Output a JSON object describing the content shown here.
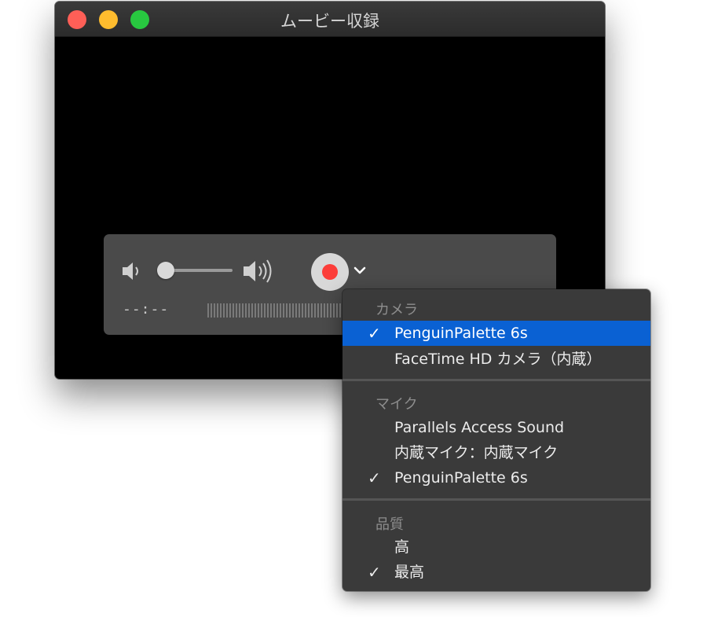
{
  "window": {
    "title": "ムービー収録"
  },
  "colors": {
    "close": "#fe5f57",
    "minimize": "#febc2e",
    "zoom": "#28c840",
    "record": "#fc3d39",
    "selection": "#0a61d3"
  },
  "controls": {
    "volume_level": 0.0,
    "timecode": "--:--",
    "icons": {
      "volume_low": "speaker-low-icon",
      "volume_high": "speaker-high-icon",
      "record": "record-icon",
      "options": "chevron-down-icon"
    }
  },
  "menu": {
    "camera": {
      "header": "カメラ",
      "items": [
        {
          "label": "PenguinPalette 6s",
          "check": "✓",
          "selected": true
        },
        {
          "label": "FaceTime HD カメラ（内蔵）",
          "check": "",
          "selected": false
        }
      ]
    },
    "mic": {
      "header": "マイク",
      "items": [
        {
          "label": "Parallels Access Sound",
          "check": ""
        },
        {
          "label": "内蔵マイク：内蔵マイク",
          "check": ""
        },
        {
          "label": "PenguinPalette 6s",
          "check": "✓"
        }
      ]
    },
    "quality": {
      "header": "品質",
      "items": [
        {
          "label": "高",
          "check": ""
        },
        {
          "label": "最高",
          "check": "✓"
        }
      ]
    }
  }
}
